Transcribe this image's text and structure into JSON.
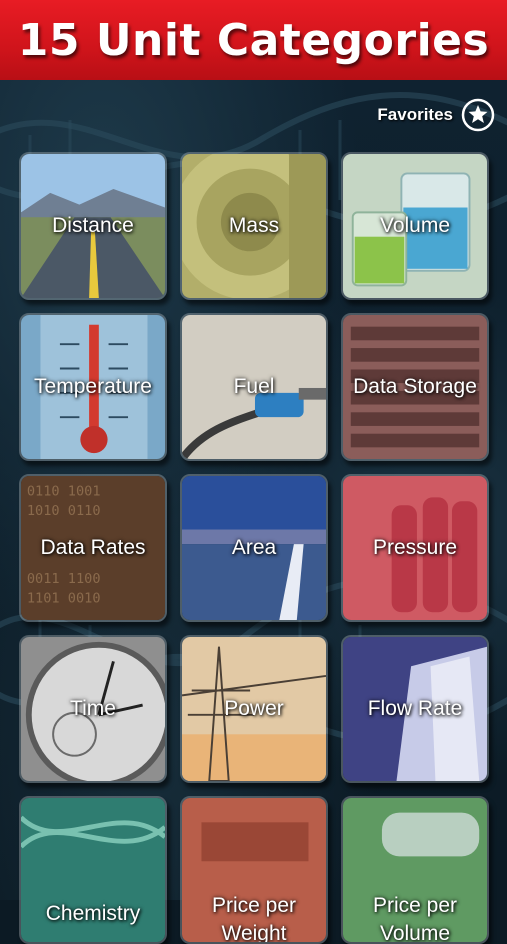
{
  "header": {
    "title": "15 Unit Categories"
  },
  "favorites": {
    "label": "Favorites",
    "icon": "star-icon"
  },
  "categories": [
    {
      "label": "Distance",
      "color": "#4f7fb8"
    },
    {
      "label": "Mass",
      "color": "#b9b46c"
    },
    {
      "label": "Volume",
      "color": "#b7ccb9"
    },
    {
      "label": "Temperature",
      "color": "#6f9cbf"
    },
    {
      "label": "Fuel",
      "color": "#c9c3b4"
    },
    {
      "label": "Data Storage",
      "color": "#8d5d5a"
    },
    {
      "label": "Data Rates",
      "color": "#6a4a32"
    },
    {
      "label": "Area",
      "color": "#2d58a6"
    },
    {
      "label": "Pressure",
      "color": "#c8505c"
    },
    {
      "label": "Time",
      "color": "#9a9a9a"
    },
    {
      "label": "Power",
      "color": "#d7c2a4"
    },
    {
      "label": "Flow Rate",
      "color": "#4a4f8a"
    },
    {
      "label": "Chemistry",
      "color": "#3f8a7a"
    },
    {
      "label": "Price per Weight",
      "color": "#c1674f"
    },
    {
      "label": "Price per Volume",
      "color": "#6a9b6a"
    }
  ]
}
